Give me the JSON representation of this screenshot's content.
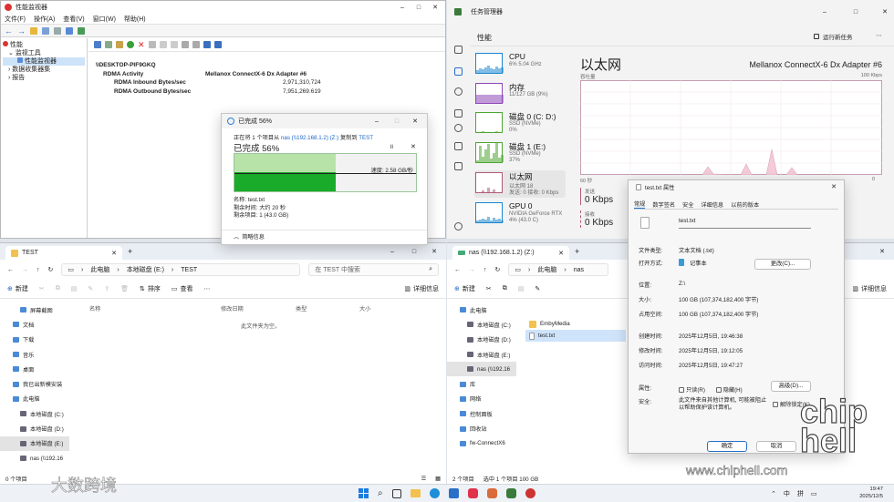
{
  "perfmon": {
    "title": "性能监视器",
    "menu": [
      "文件(F)",
      "操作(A)",
      "查看(V)",
      "窗口(W)",
      "帮助(H)"
    ],
    "tree": [
      "性能",
      "监视工具",
      "性能监视器",
      "数据收集器集",
      "报告"
    ],
    "computer": "\\\\DESKTOP-PIF9GKQ",
    "object": "RDMA Activity",
    "instance": "Mellanox ConnectX-6 Dx Adapter #6",
    "counters": [
      {
        "name": "RDMA Inbound Bytes/sec",
        "value": "2,971,310,724"
      },
      {
        "name": "RDMA Outbound Bytes/sec",
        "value": "7,951,269.619"
      }
    ]
  },
  "copy": {
    "title": "已完成 56%",
    "line_prefix": "正在将 1 个项目从",
    "src": "nas (\\\\192.168.1.2) (Z:)",
    "line_mid": "复制到",
    "dst": "TEST",
    "percent_label": "已完成 56%",
    "progress": 0.56,
    "speed": "速度: 2.58 GB/秒",
    "name": "名称: test.txt",
    "remaining_time": "剩余时间: 大约 20 秒",
    "remaining_items": "剩余项目: 1 (43.0 GB)",
    "less": "简略信息"
  },
  "tm": {
    "title": "任务管理器",
    "header": "性能",
    "run_task": "运行新任务",
    "heading": "以太网",
    "adapter": "Mellanox ConnectX-6 Dx Adapter #6",
    "throughput": "吞吐量",
    "max": "100 Kbps",
    "sec": "60 秒",
    "zero": "0",
    "send_label": "发送",
    "send_val": "0 Kbps",
    "recv_label": "接收",
    "recv_val": "0 Kbps",
    "resources": [
      {
        "name": "CPU",
        "sub1": "6% 5.04 GHz",
        "sub2": "",
        "color": "#1a86d0"
      },
      {
        "name": "内存",
        "sub1": "11/127 GB (9%)",
        "sub2": "",
        "color": "#8e47b8"
      },
      {
        "name": "磁盘 0 (C: D:)",
        "sub1": "SSD (NVMe)",
        "sub2": "0%",
        "color": "#4ca630"
      },
      {
        "name": "磁盘 1 (E:)",
        "sub1": "SSD (NVMe)",
        "sub2": "37%",
        "color": "#4ca630"
      },
      {
        "name": "以太网",
        "sub1": "以太网 18",
        "sub2": "发送: 0 接收: 0 Kbps",
        "color": "#b05a7a"
      },
      {
        "name": "GPU 0",
        "sub1": "NVIDIA GeForce RTX ...",
        "sub2": "4% (43.0 C)",
        "color": "#1a86d0"
      }
    ]
  },
  "exp1": {
    "tab": "TEST",
    "crumbs": [
      "此电脑",
      "本地磁盘 (E:)",
      "TEST"
    ],
    "search": "在 TEST 中搜索",
    "new": "新建",
    "sort": "排序",
    "view": "查看",
    "details": "详细信息",
    "cols": [
      "名称",
      "修改日期",
      "类型",
      "大小"
    ],
    "empty": "此文件夹为空。",
    "nav": [
      "屏幕截图",
      "文档",
      "下载",
      "音乐",
      "桌面",
      "我已出新模安装",
      "此电脑",
      "本地磁盘 (C:)",
      "本地磁盘 (D:)",
      "本地磁盘 (E:)",
      "nas (\\\\192.16"
    ],
    "status": "0 个项目"
  },
  "exp2": {
    "tab": "nas (\\\\192.168.1.2) (Z:)",
    "crumbs": [
      "此电脑",
      "nas"
    ],
    "search": "",
    "new": "新建",
    "details": "详细信息",
    "files": [
      "EmbyMedia",
      "test.txt"
    ],
    "nav": [
      "此电脑",
      "本地磁盘 (C:)",
      "本地磁盘 (D:)",
      "本地磁盘 (E:)",
      "nas (\\\\192.16",
      "库",
      "网络",
      "控制面板",
      "回收站",
      "fw-ConnectX6"
    ],
    "status": "2 个项目",
    "selected": "选中 1 个项目  100 GB"
  },
  "props": {
    "title": "test.txt 属性",
    "tabs": [
      "常规",
      "数字签名",
      "安全",
      "详细信息",
      "以前的版本"
    ],
    "filename": "test.txt",
    "rows": [
      {
        "k": "文件类型:",
        "v": "文本文档 (.txt)"
      },
      {
        "k": "打开方式:",
        "v": "记事本"
      },
      {
        "k": "位置:",
        "v": "Z:\\"
      },
      {
        "k": "大小:",
        "v": "100 GB (107,374,182,400 字节)"
      },
      {
        "k": "占用空间:",
        "v": "100 GB (107,374,182,400 字节)"
      },
      {
        "k": "创建时间:",
        "v": "2025年12月5日, 19:46:38"
      },
      {
        "k": "修改时间:",
        "v": "2025年12月5日, 19:12:05"
      },
      {
        "k": "访问时间:",
        "v": "2025年12月5日, 19:47:27"
      },
      {
        "k": "属性:",
        "v": ""
      },
      {
        "k": "安全:",
        "v": "此文件来自其他计算机, 可能被阻止以帮助保护该计算机。"
      }
    ],
    "change": "更改(C)...",
    "readonly": "只读(R)",
    "hidden": "隐藏(H)",
    "advanced": "高级(D)...",
    "unblock": "解除锁定(K)",
    "ok": "确定",
    "cancel": "取消"
  },
  "watermark": {
    "left": "大数跨境",
    "site": "www.chiphell.com",
    "logo": "chip hell"
  },
  "tray": {
    "ime1": "中",
    "ime2": "拼",
    "time": "19:47",
    "date": "2025/12/5"
  }
}
